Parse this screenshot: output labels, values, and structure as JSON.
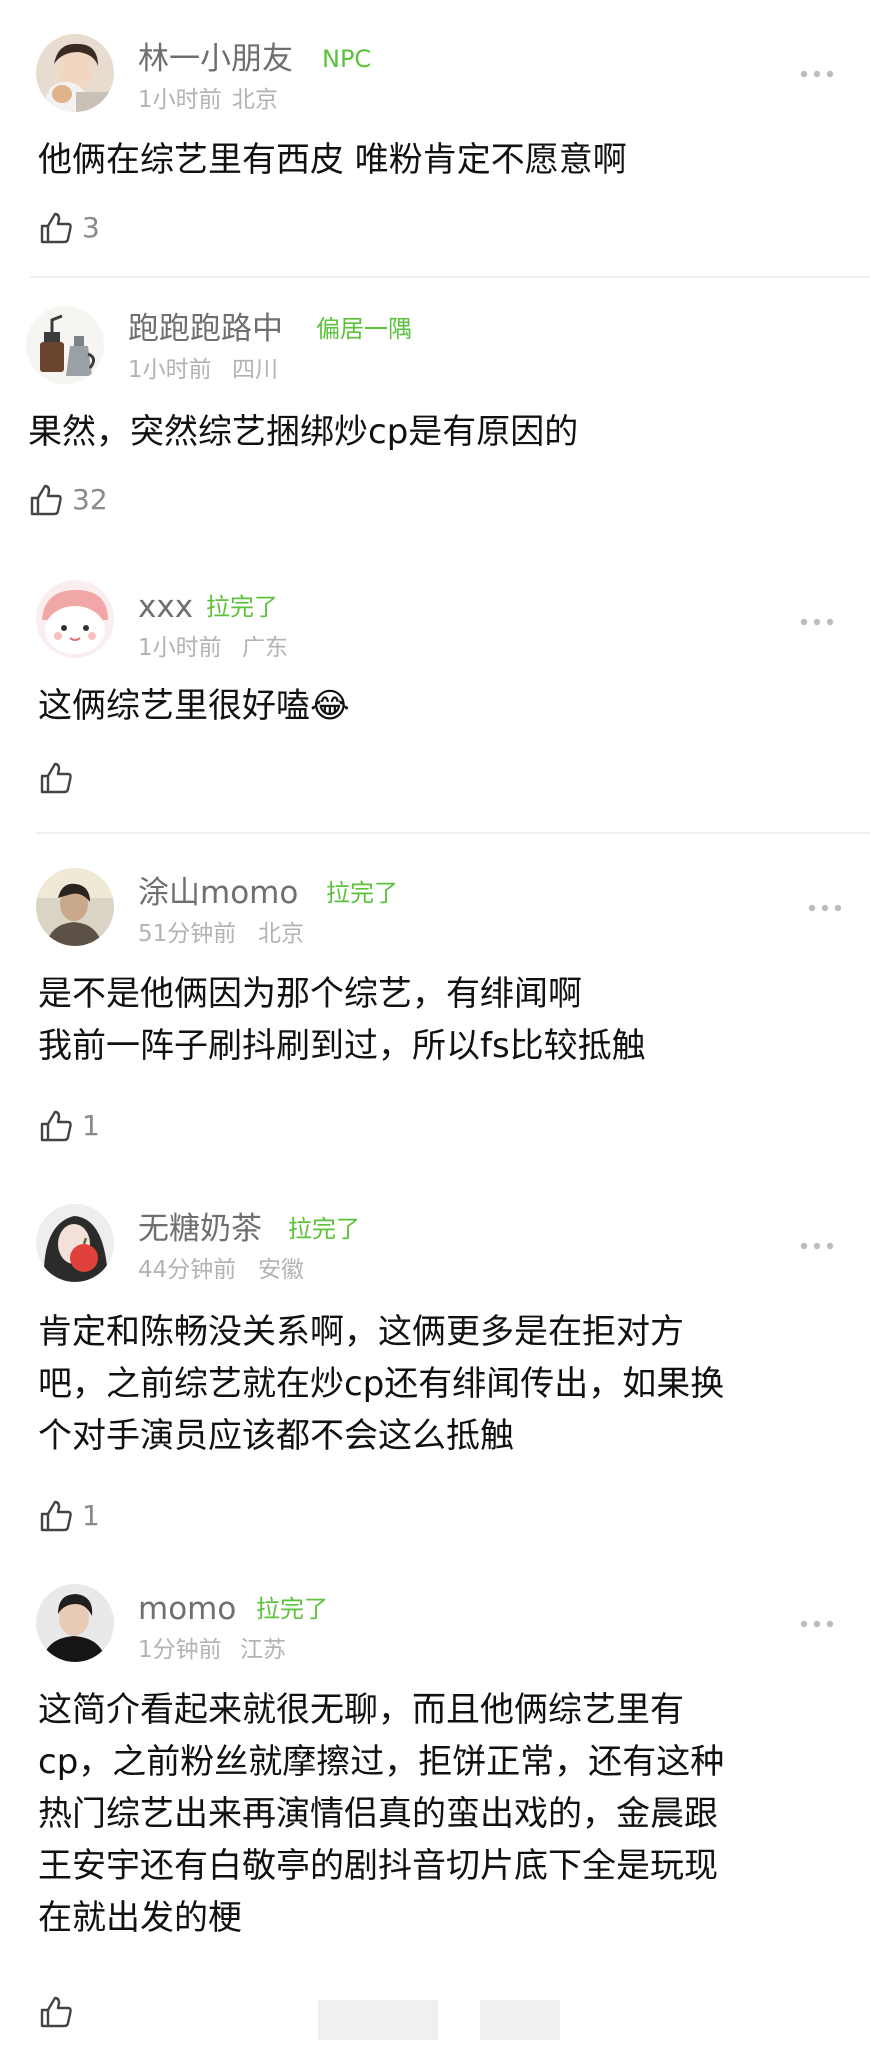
{
  "colors": {
    "tag_green": "#5cc23c",
    "username_gray": "#6f6f6f",
    "meta_gray": "#b3b3b3",
    "text_black": "#111111"
  },
  "comments": [
    {
      "username": "林一小朋友",
      "tag": "NPC",
      "time": "1小时前",
      "location": "北京",
      "content_lines": [
        "他俩在综艺里有西皮 唯粉肯定不愿意啊"
      ],
      "likes": "3",
      "avatar_icon": "avatar-boy-with-cat",
      "more_icon": "more-dots-icon"
    },
    {
      "username": "跑跑跑路中",
      "tag": "偏居一隅",
      "time": "1小时前",
      "location": "四川",
      "content_lines": [
        "果然，突然综艺捆绑炒cp是有原因的"
      ],
      "likes": "32",
      "avatar_icon": "avatar-coffee-grinder"
    },
    {
      "username": "xxx",
      "tag": "拉完了",
      "time": "1小时前",
      "location": "广东",
      "content_lines": [
        "这俩综艺里很好嗑😂"
      ],
      "likes": "",
      "avatar_icon": "avatar-cute-cartoon",
      "more_icon": "more-dots-icon"
    },
    {
      "username": "涂山momo",
      "tag": "拉完了",
      "time": "51分钟前",
      "location": "北京",
      "content_lines": [
        "是不是他俩因为那个综艺，有绯闻啊",
        "我前一阵子刷抖刷到过，所以fs比较抵触"
      ],
      "likes": "1",
      "avatar_icon": "avatar-person-photo",
      "more_icon": "more-dots-icon"
    },
    {
      "username": "无糖奶茶",
      "tag": "拉完了",
      "time": "44分钟前",
      "location": "安徽",
      "content_lines": [
        "肯定和陈畅没关系啊，这俩更多是在拒对方",
        "吧，之前综艺就在炒cp还有绯闻传出，如果换",
        "个对手演员应该都不会这么抵触"
      ],
      "likes": "1",
      "avatar_icon": "avatar-girl-with-apple",
      "more_icon": "more-dots-icon"
    },
    {
      "username": "momo",
      "tag": "拉完了",
      "time": "1分钟前",
      "location": "江苏",
      "content_lines": [
        "这简介看起来就很无聊，而且他俩综艺里有",
        "cp，之前粉丝就摩擦过，拒饼正常，还有这种",
        "热门综艺出来再演情侣真的蛮出戏的，金晨跟",
        "王安宇还有白敬亭的剧抖音切片底下全是玩现",
        "在就出发的梗"
      ],
      "likes": "",
      "avatar_icon": "avatar-man-portrait",
      "more_icon": "more-dots-icon"
    }
  ]
}
